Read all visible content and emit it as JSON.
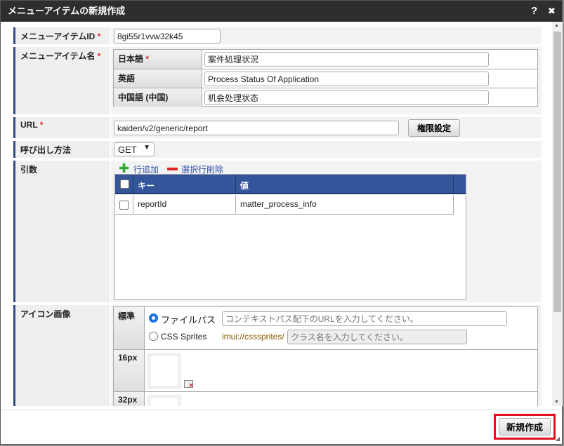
{
  "dialog": {
    "title": "メニューアイテムの新規作成",
    "help": "?",
    "close": "✖"
  },
  "menu_item_id": {
    "label": "メニューアイテムID",
    "required": "*",
    "value": "8gi55r1vvw32k45"
  },
  "menu_item_name": {
    "label": "メニューアイテム名",
    "required": "*",
    "rows": [
      {
        "label": "日本語",
        "required": "*",
        "value": "案件処理状況"
      },
      {
        "label": "英語",
        "value": "Process Status Of Application"
      },
      {
        "label": "中国語 (中国)",
        "value": "机会处理状态"
      }
    ]
  },
  "url": {
    "label": "URL",
    "required": "*",
    "value": "kaiden/v2/generic/report",
    "permission_button": "権限設定"
  },
  "call_method": {
    "label": "呼び出し方法",
    "value": "GET"
  },
  "args": {
    "label": "引数",
    "add_row": "行追加",
    "delete_rows": "選択行削除",
    "headers": [
      "キー",
      "値"
    ],
    "rows": [
      {
        "key": "reportId",
        "value": "matter_process_info"
      }
    ]
  },
  "icon": {
    "label": "アイコン画像",
    "standard_label": "標準",
    "file_path_label": "ファイルパス",
    "file_path_placeholder": "コンテキストパス配下のURLを入力してください。",
    "css_sprites_label": "CSS Sprites",
    "css_prefix": "imui://csssprites/",
    "class_placeholder": "クラス名を入力してください。",
    "size16": "16px",
    "size32": "32px"
  },
  "footer": {
    "create_button": "新規作成"
  }
}
